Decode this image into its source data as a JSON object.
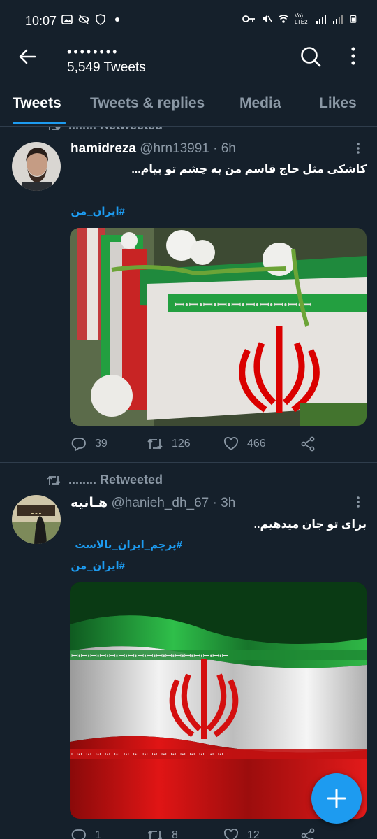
{
  "status_bar": {
    "time": "10:07",
    "network": "Vo) LTE2",
    "left_icons": [
      "image-icon",
      "eye-off-icon",
      "shield-icon",
      "dot-icon"
    ],
    "right_icons": [
      "key-icon",
      "mute-icon",
      "wifi-icon",
      "signal-icon",
      "signal-icon",
      "battery-icon"
    ]
  },
  "header": {
    "name": "••••••••",
    "tweet_count": "5,549 Tweets"
  },
  "tabs": [
    {
      "label": "Tweets",
      "active": true
    },
    {
      "label": "Tweets & replies",
      "active": false
    },
    {
      "label": "Media",
      "active": false
    },
    {
      "label": "Likes",
      "active": false
    }
  ],
  "tweets": [
    {
      "retweet_label": "........ Retweeted",
      "display_name": "hamidreza",
      "meta": "@hrn13991 · 6h",
      "text": "کاشکی مثل حاج قاسم من به چشم تو بیام...",
      "hashtags": [
        "#ایران_من"
      ],
      "counts": {
        "reply": "39",
        "retweet": "126",
        "like": "466"
      }
    },
    {
      "retweet_label": "........ Retweeted",
      "display_name": "هـانیه",
      "meta": "@hanieh_dh_67 · 3h",
      "text": "برای تو جان میدهیم..",
      "hashtags": [
        "#پرچم_ایران_بالاست",
        "#ایران_من"
      ],
      "counts": {
        "reply": "1",
        "retweet": "8",
        "like": "12"
      }
    }
  ],
  "colors": {
    "background": "#15202b",
    "accent": "#1d9bf0",
    "muted": "#8b98a5",
    "flag_green": "#239f40",
    "flag_red": "#da0000"
  }
}
